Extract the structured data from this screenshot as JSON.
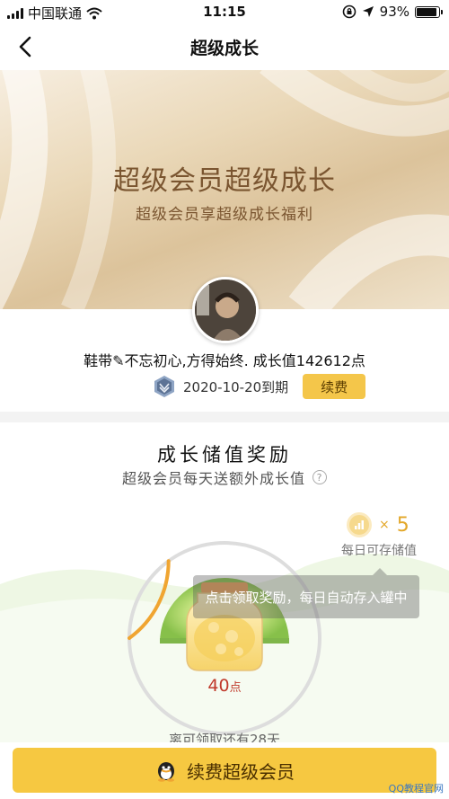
{
  "status_bar": {
    "carrier": "中国联通",
    "time": "11:15",
    "battery": "93%",
    "battery_level": 0.93,
    "icons": [
      "signal-icon",
      "wifi-icon",
      "rotation-lock-icon",
      "location-icon",
      "battery-icon"
    ]
  },
  "nav": {
    "title": "超级成长",
    "back_icon": "chevron-left-icon"
  },
  "banner": {
    "title": "超级会员超级成长",
    "subtitle": "超级会员享超级成长福利"
  },
  "user": {
    "info_line": "鞋带✎不忘初心,方得始终. 成长值142612点",
    "expire": "2020-10-20到期",
    "renew_label": "续费"
  },
  "reward": {
    "title": "成长储值奖励",
    "subtitle": "超级会员每天送额外成长值",
    "help": "?",
    "multiplier_x": "×",
    "multiplier": "5",
    "multiplier_caption": "每日可存储值",
    "tooltip": "点击领取奖励，每日自动存入罐中",
    "points": "40",
    "points_unit": "点",
    "progress_fraction": 0.3,
    "remain_text": "离可领取还有28天"
  },
  "bottom": {
    "renew_big_label": "续费超级会员",
    "watermark": "QQ教程官网"
  },
  "colors": {
    "gold_button": "#f6c841",
    "banner_text": "#7a5530",
    "points_red": "#c0392b",
    "progress_orange": "#f0a531"
  }
}
